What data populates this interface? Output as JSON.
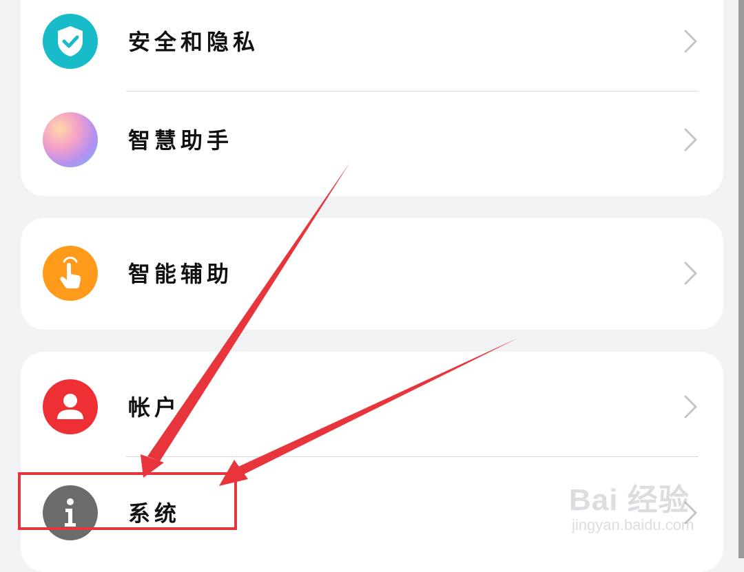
{
  "cards": [
    {
      "items": [
        {
          "label": "安全和隐私",
          "icon": "shield-check-icon",
          "color": "#18bcc8"
        },
        {
          "label": "智慧助手",
          "icon": "assistant-orb-icon",
          "color": "#c890e8"
        }
      ]
    },
    {
      "items": [
        {
          "label": "智能辅助",
          "icon": "hand-tap-icon",
          "color": "#ff9a1a"
        }
      ]
    },
    {
      "items": [
        {
          "label": "帐户",
          "icon": "user-icon",
          "color": "#ee3035"
        },
        {
          "label": "系统",
          "icon": "info-icon",
          "color": "#6b6b6b"
        }
      ]
    }
  ],
  "annotation": {
    "color": "#e8353c"
  },
  "watermark": {
    "main": "Bai 经验",
    "sub": "jingyan.baidu.com"
  }
}
